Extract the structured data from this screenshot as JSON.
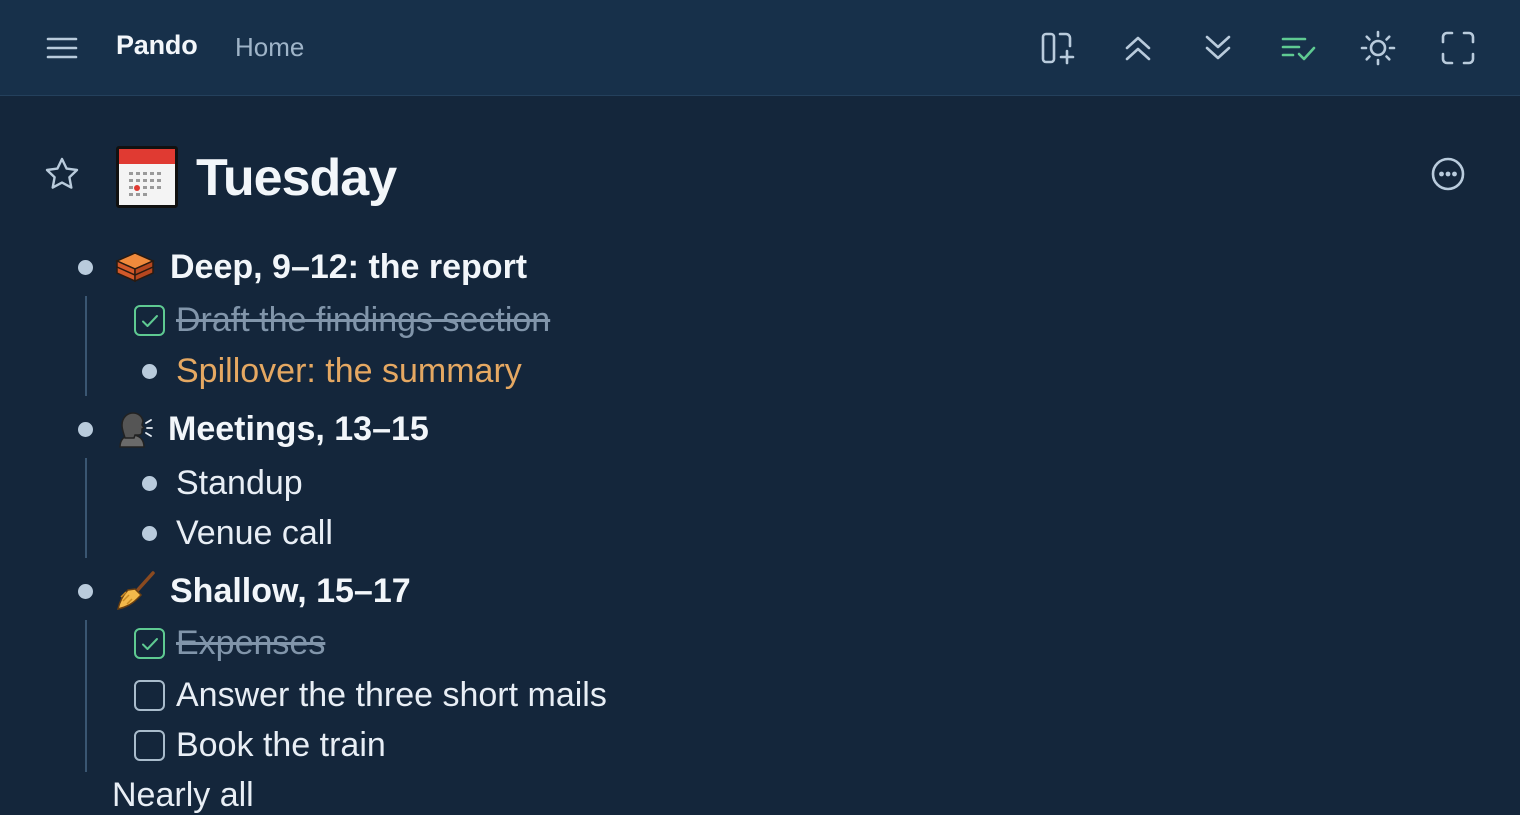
{
  "app": {
    "name": "Pando",
    "breadcrumb": "Home"
  },
  "toolbar": {
    "icons": [
      "menu-icon",
      "add-panel-icon",
      "collapse-all-icon",
      "expand-all-icon",
      "checklist-icon",
      "theme-icon",
      "fullscreen-icon"
    ],
    "accent_color": "#5fca92"
  },
  "page": {
    "title": "Tuesday",
    "title_emoji": "calendar-icon",
    "favorite": false
  },
  "outline": [
    {
      "label": "Deep, 9–12: the report",
      "emoji": "bricks-icon",
      "children": [
        {
          "type": "todo",
          "checked": true,
          "label": "Draft the findings section"
        },
        {
          "type": "bullet",
          "label": "Spillover: the summary",
          "color": "#e5a862"
        }
      ]
    },
    {
      "label": "Meetings, 13–15",
      "emoji": "speaking-head-icon",
      "children": [
        {
          "type": "bullet",
          "label": "Standup"
        },
        {
          "type": "bullet",
          "label": "Venue call"
        }
      ]
    },
    {
      "label": "Shallow, 15–17",
      "emoji": "broom-icon",
      "children": [
        {
          "type": "todo",
          "checked": true,
          "label": "Expenses"
        },
        {
          "type": "todo",
          "checked": false,
          "label": "Answer the three short mails"
        },
        {
          "type": "todo",
          "checked": false,
          "label": "Book the train"
        }
      ]
    }
  ],
  "partial_next_item": "Nearly all"
}
